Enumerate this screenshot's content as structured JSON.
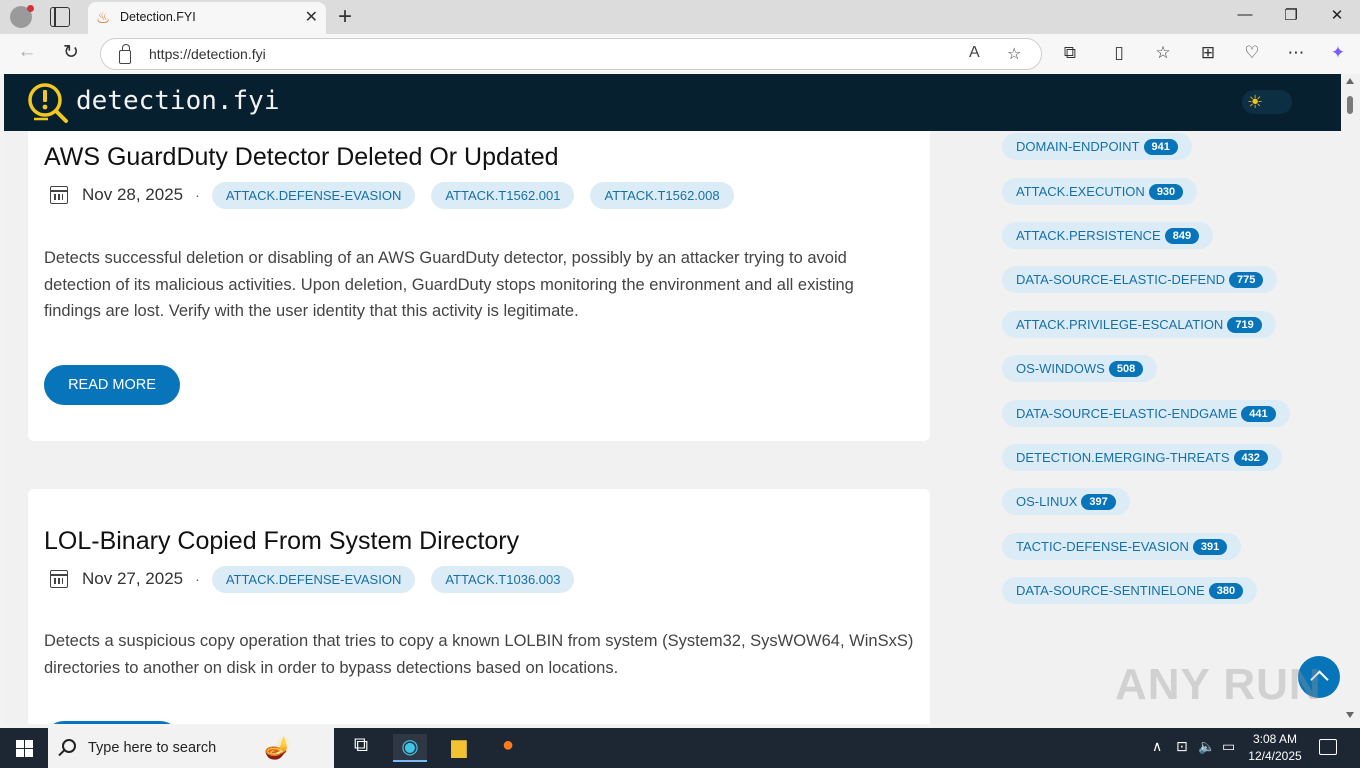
{
  "browser": {
    "tab_title": "Detection.FYI",
    "url": "https://detection.fyi",
    "close_tab": "✕",
    "new_tab": "+",
    "minimize": "—",
    "restore": "❐",
    "close_window": "✕"
  },
  "site": {
    "title": "detection.fyi"
  },
  "articles": [
    {
      "title": "AWS GuardDuty Detector Deleted Or Updated",
      "date": "Nov 28, 2025",
      "tags": [
        "ATTACK.DEFENSE-EVASION",
        "ATTACK.T1562.001",
        "ATTACK.T1562.008"
      ],
      "description": "Detects successful deletion or disabling of an AWS GuardDuty detector, possibly by an attacker trying to avoid detection of its malicious activities. Upon deletion, GuardDuty stops monitoring the environment and all existing findings are lost. Verify with the user identity that this activity is legitimate.",
      "button": "READ MORE"
    },
    {
      "title": "LOL-Binary Copied From System Directory",
      "date": "Nov 27, 2025",
      "tags": [
        "ATTACK.DEFENSE-EVASION",
        "ATTACK.T1036.003"
      ],
      "description": "Detects a suspicious copy operation that tries to copy a known LOLBIN from system (System32, SysWOW64, WinSxS) directories to another on disk in order to bypass detections based on locations."
    }
  ],
  "sidebar_tags": [
    {
      "label": "DOMAIN-ENDPOINT",
      "count": "941"
    },
    {
      "label": "ATTACK.EXECUTION",
      "count": "930"
    },
    {
      "label": "ATTACK.PERSISTENCE",
      "count": "849"
    },
    {
      "label": "DATA-SOURCE-ELASTIC-DEFEND",
      "count": "775"
    },
    {
      "label": "ATTACK.PRIVILEGE-ESCALATION",
      "count": "719"
    },
    {
      "label": "OS-WINDOWS",
      "count": "508"
    },
    {
      "label": "DATA-SOURCE-ELASTIC-ENDGAME",
      "count": "441"
    },
    {
      "label": "DETECTION.EMERGING-THREATS",
      "count": "432"
    },
    {
      "label": "OS-LINUX",
      "count": "397"
    },
    {
      "label": "TACTIC-DEFENSE-EVASION",
      "count": "391"
    },
    {
      "label": "DATA-SOURCE-SENTINELONE",
      "count": "380"
    }
  ],
  "watermark": "ANY RUN",
  "taskbar": {
    "search_placeholder": "Type here to search",
    "time": "3:08 AM",
    "date": "12/4/2025"
  },
  "colors": {
    "header_bg": "#06202f",
    "accent": "#0875bb",
    "tag_bg": "#dcecf6",
    "tag_text": "#1670a8"
  }
}
